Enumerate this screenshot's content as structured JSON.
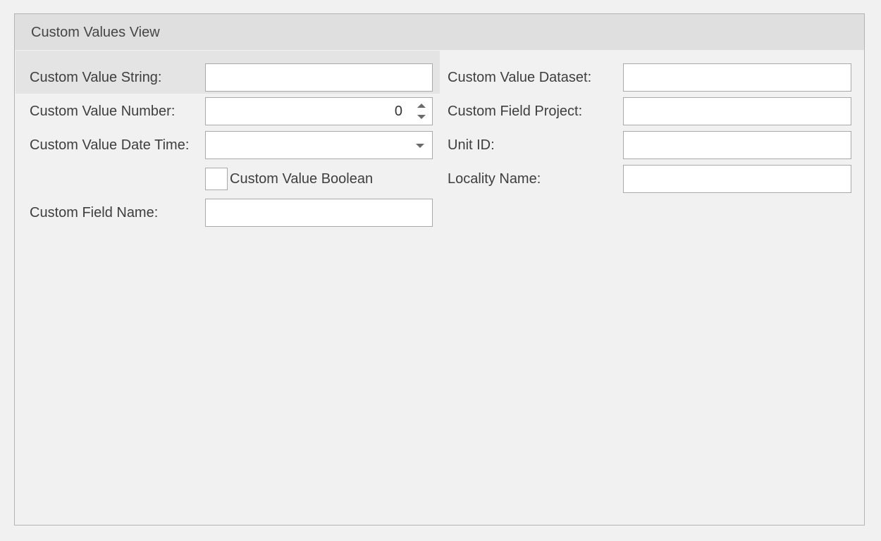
{
  "group": {
    "title": "Custom Values View"
  },
  "left": {
    "string_label": "Custom Value String:",
    "string_value": "",
    "number_label": "Custom Value Number:",
    "number_value": "0",
    "datetime_label": "Custom Value Date Time:",
    "datetime_value": "",
    "boolean_label": "Custom Value Boolean",
    "boolean_checked": false,
    "fieldname_label": "Custom Field Name:",
    "fieldname_value": ""
  },
  "right": {
    "dataset_label": "Custom Value Dataset:",
    "dataset_value": "",
    "project_label": "Custom Field Project:",
    "project_value": "",
    "unitid_label": "Unit ID:",
    "unitid_value": "",
    "locality_label": "Locality Name:",
    "locality_value": ""
  },
  "icons": {
    "spin": "spin-up-down-icon",
    "dropdown": "chevron-down-icon"
  }
}
